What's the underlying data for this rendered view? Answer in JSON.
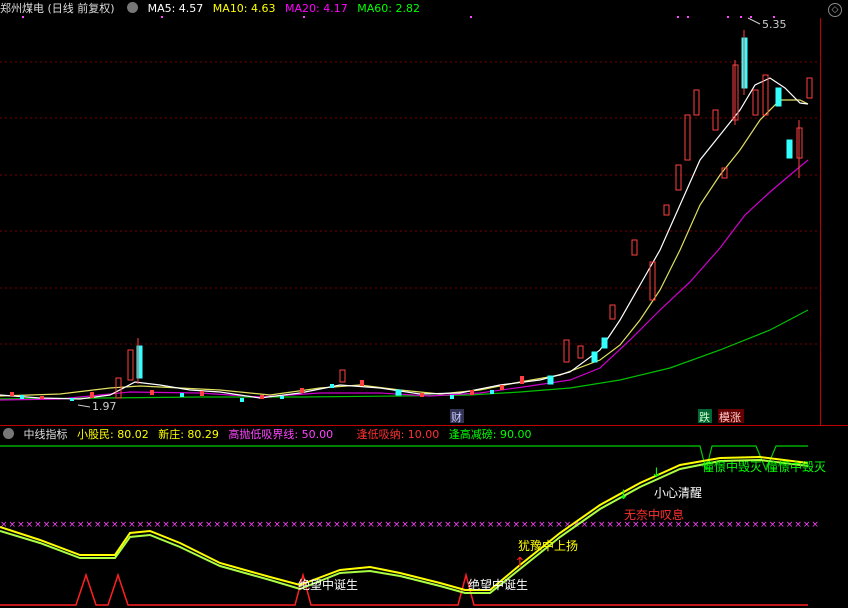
{
  "main_chart": {
    "title": "郑州煤电 (日线 前复权)",
    "ma5": {
      "label": "MA5: 4.57",
      "color": "#ffffff"
    },
    "ma10": {
      "label": "MA10: 4.63",
      "color": "#ffff00"
    },
    "ma20": {
      "label": "MA20: 4.17",
      "color": "#ff00ff"
    },
    "ma60": {
      "label": "MA60: 2.82",
      "color": "#00ff00"
    },
    "high_label": "5.35",
    "low_label": "1.97",
    "marker_cai": "财",
    "marker_die": "跌",
    "marker_zhang": "模涨",
    "gear_icon": "gear-icon"
  },
  "indicator": {
    "name": "中线指标",
    "small_investor": "小股民: 80.02",
    "new_dealer": "新庄: 80.29",
    "boundary": "高抛低吸界线: 50.00",
    "low_buy": "逢低吸纳: 10.00",
    "high_sell": "逢高减磅: 90.00",
    "annotations": [
      {
        "text": "绝望中诞生",
        "color": "#ffffff"
      },
      {
        "text": "绝望中诞生",
        "color": "#ffffff"
      },
      {
        "text": "犹豫中上扬",
        "color": "#ffff00"
      },
      {
        "text": "无奈中叹息",
        "color": "#ff3030"
      },
      {
        "text": "小心清醒",
        "color": "#ffffff"
      },
      {
        "text": "憧憬中毁灭",
        "color": "#00ff00"
      },
      {
        "text": "憧憬中毁灭",
        "color": "#00ff00"
      }
    ]
  }
}
